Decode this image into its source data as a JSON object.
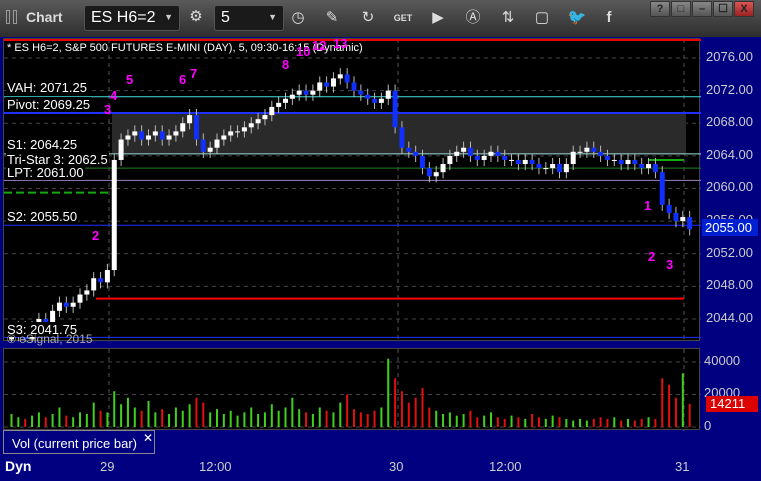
{
  "app": {
    "title": "Chart",
    "symbol": "ES H6=2",
    "interval": "5"
  },
  "toolbar": [
    "pencil-icon",
    "refresh-icon",
    "get-icon",
    "play-icon",
    "alert-icon",
    "link-icon",
    "comment-icon",
    "twitter-icon",
    "facebook-icon"
  ],
  "window_buttons": [
    "?",
    "□",
    "–",
    "☐",
    "X"
  ],
  "chart": {
    "header": "* ES H6=2, S&P 500 FUTURES E-MINI (DAY), 5, 09:30-16:15 (Dynamic)",
    "copyright": "© eSignal, 2015",
    "price_ticks": [
      "2076.00",
      "2072.00",
      "2068.00",
      "2064.00",
      "2060.00",
      "2056.00",
      "2052.00",
      "2048.00",
      "2044.00"
    ],
    "current_price": "2055.00",
    "levels": [
      {
        "label": "VAH: 2071.25",
        "price": 2071.25,
        "color": "#40e0e0"
      },
      {
        "label": "Pivot: 2069.25",
        "price": 2069.25,
        "color": "#2030ff"
      },
      {
        "label": "S1: 2064.25",
        "price": 2064.25,
        "color": "#a0e0e0"
      },
      {
        "label": "Tri-Star 3: 2062.5",
        "price": 2062.5,
        "color": "#208020"
      },
      {
        "label": "LPT: 2061.00",
        "price": 2061.0,
        "color": "#a080c0"
      },
      {
        "label": "S2: 2055.50",
        "price": 2055.5,
        "color": "#2030ff"
      },
      {
        "label": "S3: 2041.75",
        "price": 2041.75,
        "color": "#2030ff"
      }
    ],
    "red_level": 2046.5,
    "annotations": [
      "1",
      "2",
      "3",
      "4",
      "5",
      "6",
      "7",
      "8",
      "10",
      "12",
      "13",
      "1",
      "2",
      "3"
    ],
    "closes": [
      2042,
      2043,
      2041.5,
      2043,
      2044,
      2043,
      2045,
      2046,
      2045.5,
      2046,
      2047,
      2047.5,
      2049,
      2048.5,
      2050,
      2063.5,
      2066,
      2066.5,
      2067,
      2066,
      2066.5,
      2067,
      2066,
      2066.5,
      2067,
      2068,
      2069,
      2066,
      2064.5,
      2065,
      2066,
      2066.5,
      2067,
      2067,
      2067.5,
      2068,
      2068.5,
      2069,
      2070,
      2070.5,
      2071,
      2071.5,
      2072,
      2071.5,
      2072,
      2073,
      2072.5,
      2073.5,
      2074,
      2073,
      2072,
      2071.5,
      2071,
      2070.5,
      2071,
      2072,
      2067.5,
      2065,
      2064.5,
      2064,
      2062.5,
      2061.5,
      2062,
      2063,
      2064,
      2064.5,
      2065,
      2064,
      2063.5,
      2064,
      2064.5,
      2064,
      2063.5,
      2063.5,
      2063,
      2063.5,
      2063,
      2062.5,
      2062.5,
      2063,
      2062,
      2063,
      2064.5,
      2064.5,
      2065,
      2064.5,
      2064,
      2063.5,
      2063.5,
      2063,
      2063.5,
      2063,
      2062.5,
      2063,
      2062,
      2058,
      2057,
      2056,
      2056.5,
      2055
    ],
    "volume_ticks": [
      "40000",
      "20000",
      "0"
    ],
    "volume_current": "14211",
    "volumes": [
      8000,
      6000,
      5000,
      7000,
      9000,
      6000,
      8000,
      12000,
      7000,
      6000,
      9000,
      8000,
      15000,
      10000,
      9000,
      22000,
      14000,
      18000,
      12000,
      10000,
      16000,
      9000,
      11000,
      8000,
      12000,
      10000,
      14000,
      18000,
      15000,
      9000,
      11000,
      8000,
      10000,
      7000,
      9000,
      12000,
      8000,
      9000,
      14000,
      10000,
      12000,
      18000,
      11000,
      9000,
      8000,
      12000,
      10000,
      9000,
      15000,
      20000,
      11000,
      9000,
      8000,
      10000,
      12000,
      42000,
      30000,
      22000,
      15000,
      18000,
      24000,
      12000,
      10000,
      8000,
      9000,
      7000,
      8000,
      10000,
      6000,
      7000,
      9000,
      6000,
      5000,
      7000,
      6000,
      5000,
      8000,
      6000,
      5000,
      7000,
      6000,
      5000,
      4000,
      5000,
      4000,
      5000,
      6000,
      5000,
      6000,
      4000,
      5000,
      4000,
      5000,
      6000,
      5000,
      30000,
      26000,
      18000,
      33000,
      14211
    ],
    "time_labels": [
      "29",
      "12:00",
      "30",
      "12:00",
      "31"
    ],
    "vol_title": "Vol (current price bar)",
    "footer": "Dyn"
  }
}
